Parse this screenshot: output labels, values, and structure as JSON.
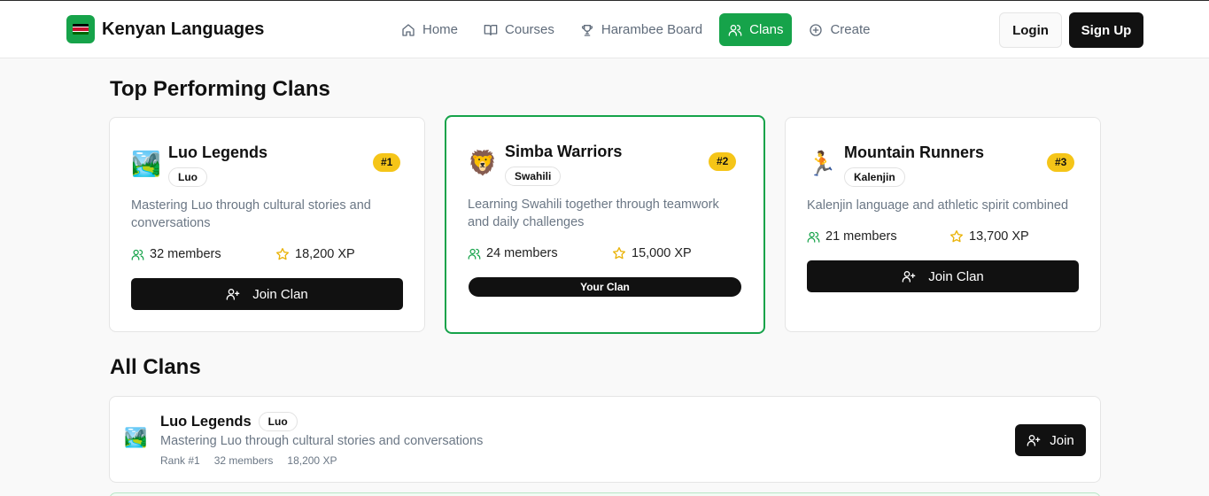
{
  "brand": {
    "name": "Kenyan Languages",
    "logo_icon": "kenya-flag-icon",
    "accent": "#16a34a"
  },
  "nav": {
    "items": [
      {
        "label": "Home",
        "icon": "home-icon",
        "active": false
      },
      {
        "label": "Courses",
        "icon": "book-icon",
        "active": false
      },
      {
        "label": "Harambee Board",
        "icon": "trophy-icon",
        "active": false
      },
      {
        "label": "Clans",
        "icon": "users-icon",
        "active": true
      },
      {
        "label": "Create",
        "icon": "plus-circle-icon",
        "active": false
      }
    ],
    "login_label": "Login",
    "signup_label": "Sign Up"
  },
  "top": {
    "heading": "Top Performing Clans",
    "clans": [
      {
        "name": "Luo Legends",
        "language": "Luo",
        "rank": "#1",
        "description": "Mastering Luo through cultural stories and conversations",
        "members": "32 members",
        "xp": "18,200 XP",
        "action": "Join Clan",
        "emoji": "🏞️"
      },
      {
        "name": "Simba Warriors",
        "language": "Swahili",
        "rank": "#2",
        "description": "Learning Swahili together through teamwork and daily challenges",
        "members": "24 members",
        "xp": "15,000 XP",
        "status": "Your Clan",
        "emoji": "🦁"
      },
      {
        "name": "Mountain Runners",
        "language": "Kalenjin",
        "rank": "#3",
        "description": "Kalenjin language and athletic spirit combined",
        "members": "21 members",
        "xp": "13,700 XP",
        "action": "Join Clan",
        "emoji": "🏃"
      }
    ]
  },
  "all": {
    "heading": "All Clans",
    "rows": [
      {
        "name": "Luo Legends",
        "language": "Luo",
        "description": "Mastering Luo through cultural stories and conversations",
        "rank": "Rank #1",
        "members": "32 members",
        "xp": "18,200 XP",
        "action": "Join",
        "emoji": "🏞️"
      }
    ]
  },
  "colors": {
    "rank_badge": "#f5c518",
    "primary_button": "#111111",
    "muted_text": "#6b7785"
  }
}
